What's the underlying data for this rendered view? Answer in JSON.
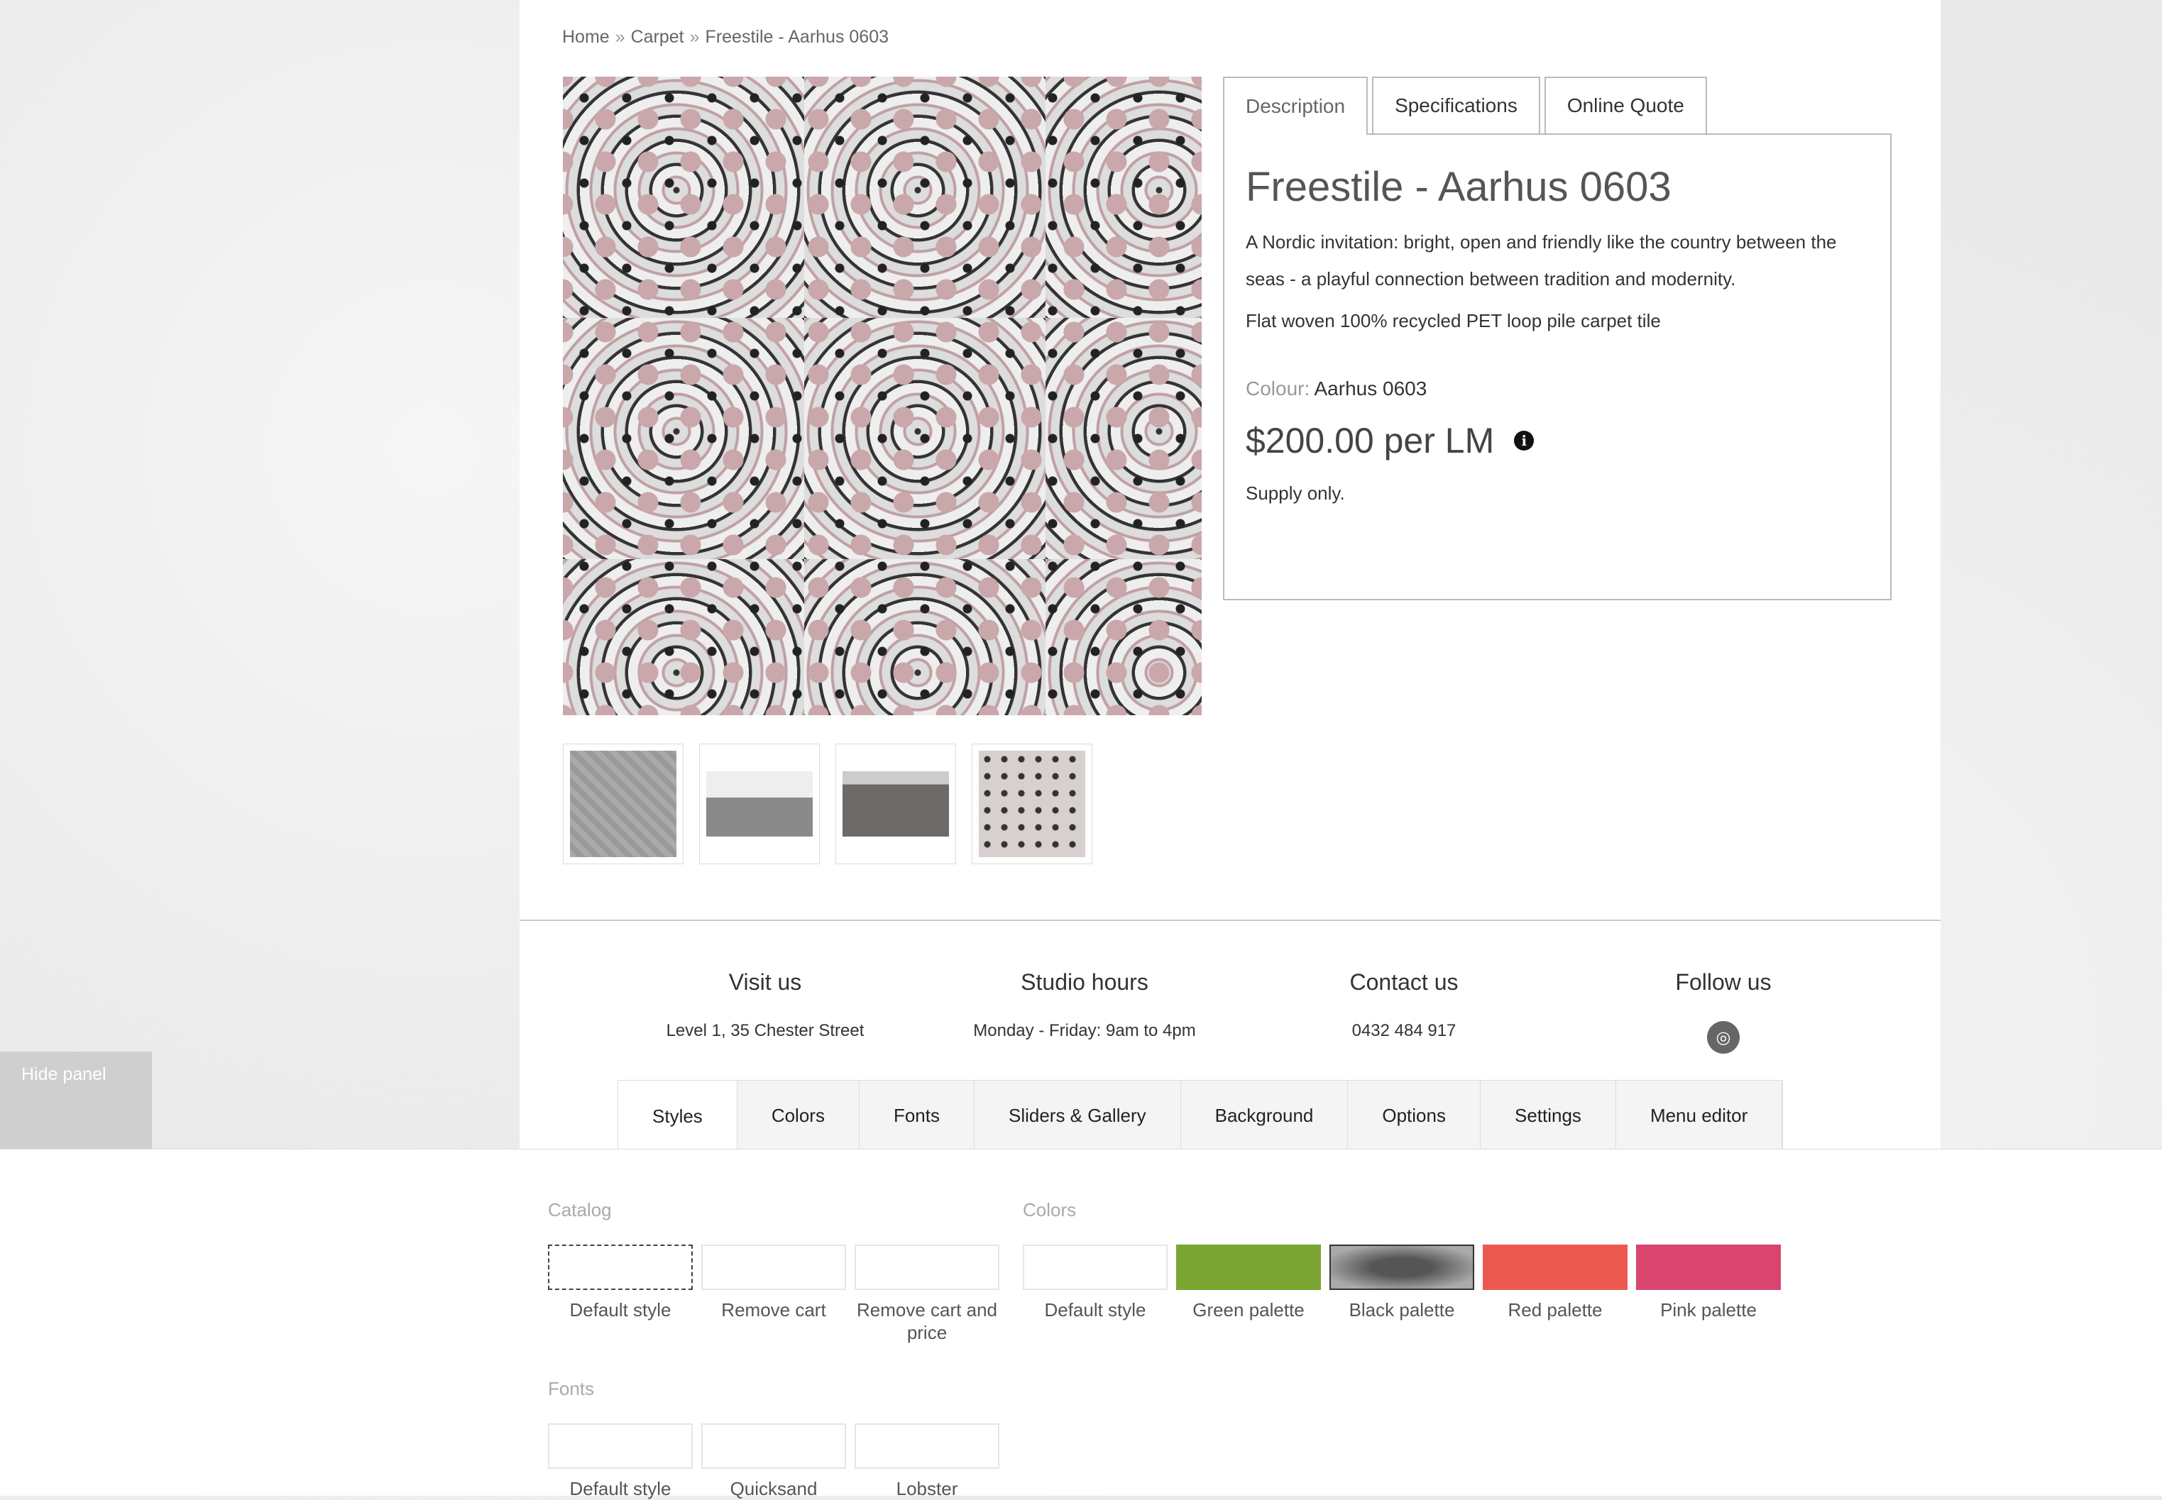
{
  "breadcrumb": {
    "home": "Home",
    "sep": "»",
    "category": "Carpet",
    "current": "Freestile - Aarhus 0603"
  },
  "product": {
    "tabs": [
      "Description",
      "Specifications",
      "Online Quote"
    ],
    "title": "Freestile - Aarhus 0603",
    "description": "A Nordic invitation: bright, open and friendly like the country between the seas - a playful connection between tradition and modernity.",
    "spec": "Flat woven 100% recycled PET loop pile carpet tile",
    "colour_label": "Colour:",
    "colour_value": "Aarhus 0603",
    "price": "$200.00 per LM",
    "info_icon": "i",
    "supply": "Supply only."
  },
  "footer": {
    "visit": {
      "title": "Visit us",
      "line1": "Level 1, 35 Chester Street"
    },
    "hours": {
      "title": "Studio hours",
      "line1": "Monday - Friday: 9am to 4pm"
    },
    "contact": {
      "title": "Contact us",
      "line1": "0432 484 917"
    },
    "follow": {
      "title": "Follow us",
      "instagram_icon": "◎"
    }
  },
  "panel": {
    "hide_label": "Hide panel",
    "tabs": [
      "Styles",
      "Colors",
      "Fonts",
      "Sliders & Gallery",
      "Background",
      "Options",
      "Settings",
      "Menu editor"
    ],
    "catalog": {
      "label": "Catalog",
      "items": [
        "Default style",
        "Remove cart",
        "Remove cart and price"
      ]
    },
    "colors": {
      "label": "Colors",
      "items": [
        "Default style",
        "Green palette",
        "Black palette",
        "Red palette",
        "Pink palette"
      ],
      "hex": [
        "#ffffff",
        "#7aa532",
        "#666666",
        "#ec5a4f",
        "#d9456f"
      ]
    },
    "fonts": {
      "label": "Fonts",
      "items": [
        "Default style",
        "Quicksand",
        "Lobster"
      ]
    }
  }
}
